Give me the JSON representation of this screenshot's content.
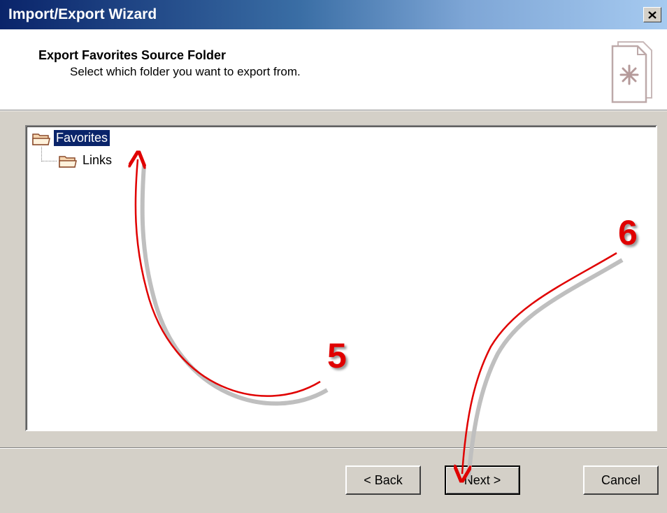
{
  "window": {
    "title": "Import/Export Wizard"
  },
  "titlebar": {
    "close_icon": "close-icon"
  },
  "header": {
    "title": "Export Favorites Source Folder",
    "subtitle": "Select which folder you want to export from.",
    "icon": "wizard-page-icon"
  },
  "tree": {
    "items": [
      {
        "label": "Favorites",
        "selected": true,
        "icon": "folder-icon"
      },
      {
        "label": "Links",
        "selected": false,
        "icon": "folder-icon"
      }
    ]
  },
  "buttons": {
    "back": "< Back",
    "next": "Next >",
    "cancel": "Cancel"
  },
  "annotations": {
    "step5": "5",
    "step6": "6",
    "color": "#e00000"
  }
}
